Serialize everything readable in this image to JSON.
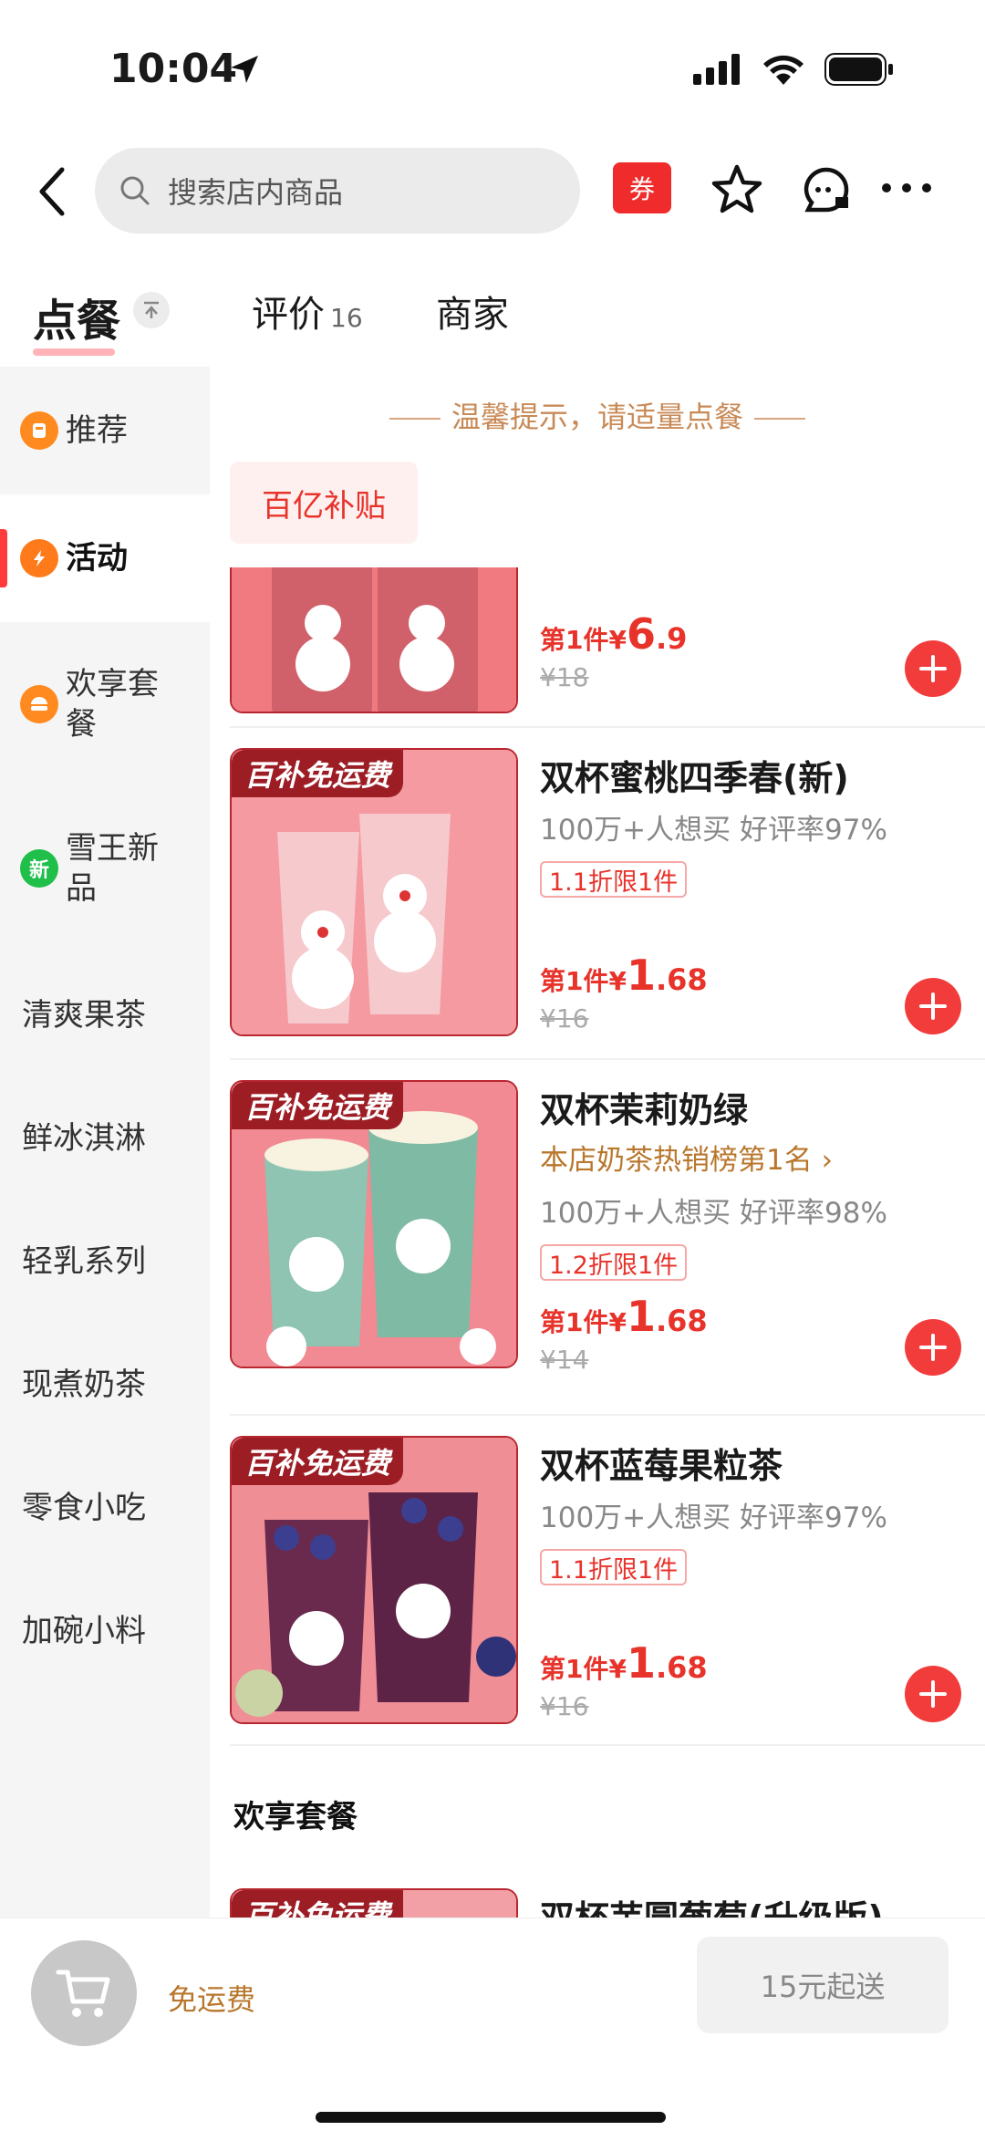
{
  "status": {
    "time": "10:04"
  },
  "nav": {
    "search_placeholder": "搜索店内商品",
    "coupon_label": "券"
  },
  "tabs": {
    "order": "点餐",
    "reviews": "评价",
    "reviews_count": "16",
    "merchant": "商家"
  },
  "sidebar": {
    "items": [
      {
        "label": "推荐",
        "icon": "recommend-icon",
        "color": "#ff8a1f"
      },
      {
        "label": "活动",
        "icon": "lightning-icon",
        "color": "#ff7a1a"
      },
      {
        "label": "欢享套餐",
        "icon": "combo-icon",
        "color": "#ff8a1f"
      },
      {
        "label": "雪王新品",
        "icon": "new-badge-icon",
        "color": "#1fbf4a",
        "icon_text": "新"
      },
      {
        "label": "清爽果茶"
      },
      {
        "label": "鲜冰淇淋"
      },
      {
        "label": "轻乳系列"
      },
      {
        "label": "现煮奶茶"
      },
      {
        "label": "零食小吃"
      },
      {
        "label": "加碗小料"
      }
    ]
  },
  "main": {
    "tip": "温馨提示，请适量点餐",
    "subsidy_tag": "百亿补贴",
    "products": [
      {
        "badge": "",
        "name": "",
        "price_prefix": "第1件",
        "currency": "¥",
        "price_int": "6",
        "price_dec": ".9",
        "original": "¥18"
      },
      {
        "badge": "百补免运费",
        "name": "双杯蜜桃四季春(新)",
        "sales": "100万+人想买 好评率97%",
        "discount": "1.1折限1件",
        "price_prefix": "第1件",
        "currency": "¥",
        "price_int": "1",
        "price_dec": ".68",
        "original": "¥16"
      },
      {
        "badge": "百补免运费",
        "name": "双杯茉莉奶绿",
        "rank": "本店奶茶热销榜第1名 ›",
        "sales": "100万+人想买 好评率98%",
        "discount": "1.2折限1件",
        "price_prefix": "第1件",
        "currency": "¥",
        "price_int": "1",
        "price_dec": ".68",
        "original": "¥14"
      },
      {
        "badge": "百补免运费",
        "name": "双杯蓝莓果粒茶",
        "sales": "100万+人想买 好评率97%",
        "discount": "1.1折限1件",
        "price_prefix": "第1件",
        "currency": "¥",
        "price_int": "1",
        "price_dec": ".68",
        "original": "¥16"
      },
      {
        "badge": "百补免运费",
        "name": "双杯芋圆葡萄(升级版)"
      }
    ],
    "section_combo": "欢享套餐"
  },
  "bottom": {
    "free_delivery": "免运费",
    "min_order": "15元起送"
  },
  "colors": {
    "accent": "#f23c3c",
    "price": "#e8332b",
    "gold": "#b8772c"
  }
}
